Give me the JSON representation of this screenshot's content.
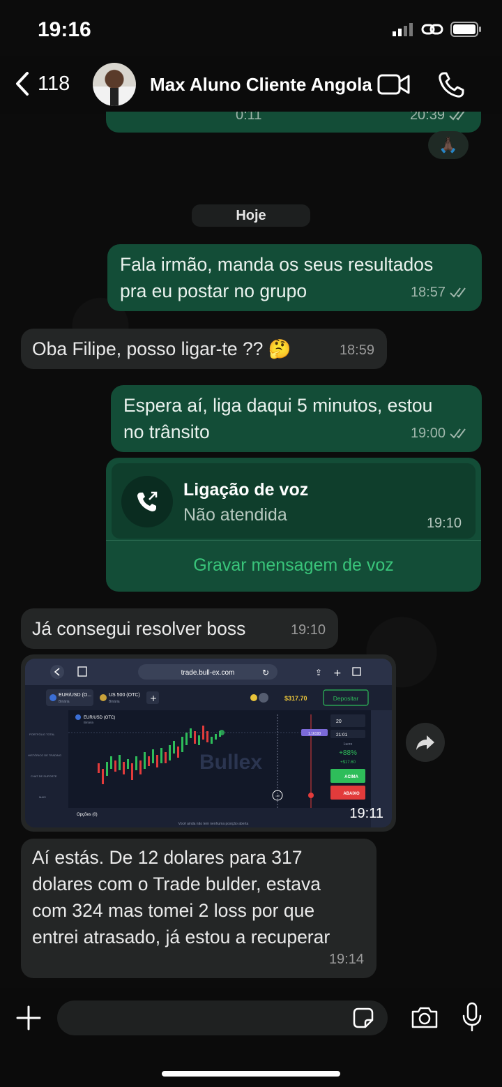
{
  "status_bar": {
    "time": "19:16"
  },
  "header": {
    "back_count": "118",
    "contact_name": "Max Aluno Cliente Angola"
  },
  "messages": {
    "prev_voice": {
      "duration": "0:11",
      "time": "20:39",
      "reaction": "🙏🏿"
    },
    "date_divider": "Hoje",
    "m1": {
      "text_line1": "Fala irmão, manda os seus resultados",
      "text_line2": "pra eu postar no grupo",
      "time": "18:57"
    },
    "m2": {
      "text": "Oba Filipe, posso ligar-te ?? 🤔",
      "time": "18:59"
    },
    "m3": {
      "text_line1": "Espera aí, liga daqui 5 minutos, estou",
      "text_line2": "no trânsito",
      "time": "19:00"
    },
    "call": {
      "title": "Ligação de voz",
      "status": "Não atendida",
      "time": "19:10",
      "action": "Gravar mensagem de voz"
    },
    "m4": {
      "text": "Já consegui resolver boss",
      "time": "19:10"
    },
    "image": {
      "time": "19:11",
      "url": "trade.bull-ex.com",
      "tab1": "EUR/USD (O...",
      "tab1_sub": "Binária",
      "tab2": "US 500 (OTC)",
      "tab2_sub": "Binária",
      "balance": "$317.70",
      "deposit": "Depositar",
      "pair": "EUR/USD (OTC)",
      "pair_sub": "Binária",
      "amount": "20",
      "timer": "21:01",
      "profit_label": "Lucro",
      "profit_pct": "+88%",
      "profit_value": "+$17.60",
      "up_label": "ACIMA",
      "down_label": "ABAIXO",
      "brand": "Bullex",
      "options_tab": "Opções (0)",
      "no_positions": "Você ainda não tem nenhuma posição aberta",
      "side_menu": [
        "PORTFÓLIO TOTAL",
        "HISTÓRICO DE TRADING",
        "CHAT DE SUPORTE",
        "MAIS"
      ],
      "price_tag": "1.16193",
      "countdown": ":49"
    },
    "m5": {
      "line1": "Aí estás. De 12 dolares para 317",
      "line2": "dolares com o Trade bulder, estava",
      "line3": "com 324 mas tomei 2 loss por que",
      "line4": "entrei atrasado, já estou a recuperar",
      "time": "19:14"
    }
  },
  "input": {
    "placeholder": ""
  }
}
